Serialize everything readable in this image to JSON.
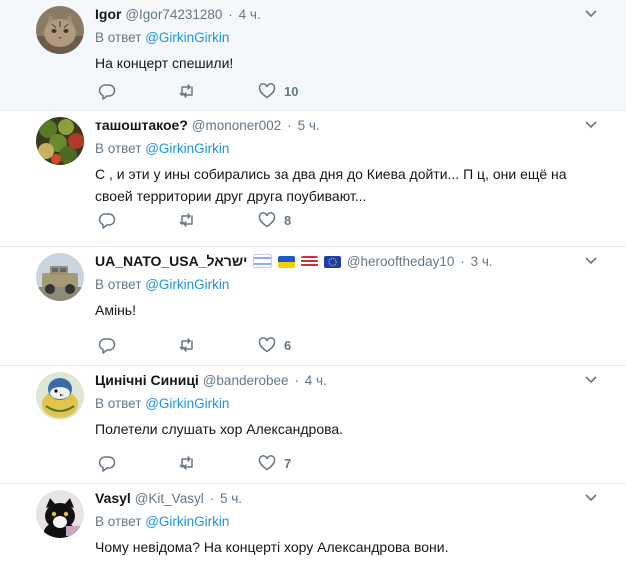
{
  "colors": {
    "accent": "#1b95e0",
    "muted": "#657786",
    "text": "#14171a",
    "divider": "#e6ecf0",
    "highlight_bg": "#f5f8fa"
  },
  "reply_prefix": "В ответ",
  "tweets": [
    {
      "fullname": "Igor",
      "handle": "@Igor74231280",
      "time": "4 ч.",
      "mention": "@GirkinGirkin",
      "text": "На концерт спешили!",
      "like_count": "10",
      "avatar_icon": "cat-avatar"
    },
    {
      "fullname": "ташоштакое?",
      "handle": "@mononer002",
      "time": "5 ч.",
      "mention": "@GirkinGirkin",
      "text": "С   , и эти у   ины собирались за два дня до Киева дойти... П   ц, они ещё на своей территории друг друга поубивают...",
      "like_count": "8",
      "avatar_icon": "food-avatar"
    },
    {
      "fullname": "UA_NATO_USA_ישראל",
      "handle": "@herooftheday10",
      "time": "3 ч.",
      "mention": "@GirkinGirkin",
      "text": "Амінь!",
      "like_count": "6",
      "avatar_icon": "military-vehicle-avatar",
      "flags": [
        "israel-flag",
        "ukraine-flag",
        "usa-flag",
        "eu-flag"
      ]
    },
    {
      "fullname": "Цинічні Синиці",
      "handle": "@banderobee",
      "time": "4 ч.",
      "mention": "@GirkinGirkin",
      "text": "Полетели слушать хор Александрова.",
      "like_count": "7",
      "avatar_icon": "titmouse-bird-avatar"
    },
    {
      "fullname": "Vasyl",
      "handle": "@Kit_Vasyl",
      "time": "5 ч.",
      "mention": "@GirkinGirkin",
      "text": "Чому невідома? На концерті хору Александрова вони.",
      "avatar_icon": "black-cat-avatar"
    }
  ]
}
